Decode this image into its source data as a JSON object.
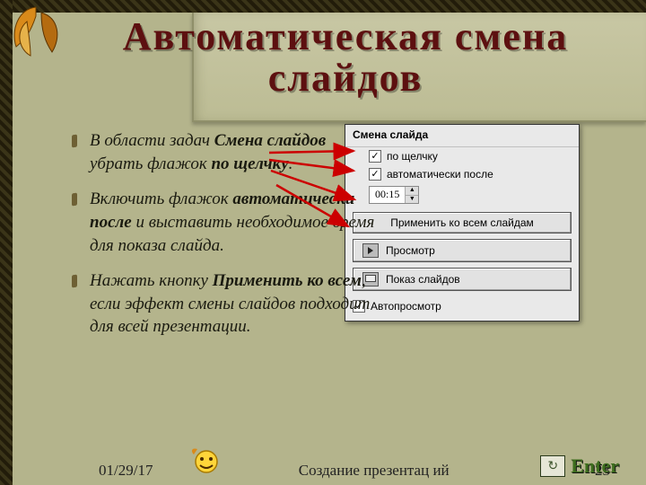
{
  "title": "Автоматическая смена слайдов",
  "bullets": {
    "b1_a": "В области задач ",
    "b1_b": "Смена слайдов",
    "b1_c": "  убрать флажок ",
    "b1_d": "по щелчку",
    "b1_e": ".",
    "b2_a": "Включить флажок ",
    "b2_b": "автоматически после",
    "b2_c": " и выставить необходимое время для показа слайда.",
    "b3_a": "Нажать кнопку ",
    "b3_b": "Применить ко всем",
    "b3_c": ", если эффект смены слайдов подходит для всей презентации."
  },
  "dialog": {
    "header": "Смена слайда",
    "chk_click": "по щелчку",
    "chk_auto": "автоматически после",
    "time": "00:15",
    "btn_apply": "Применить ко всем слайдам",
    "btn_preview": "Просмотр",
    "btn_show": "Показ слайдов",
    "chk_autoview": "Автопросмотр"
  },
  "footer": {
    "date": "01/29/17",
    "caption": "Создание презентац ий",
    "page": "23"
  },
  "enter": {
    "label": "Enter"
  }
}
